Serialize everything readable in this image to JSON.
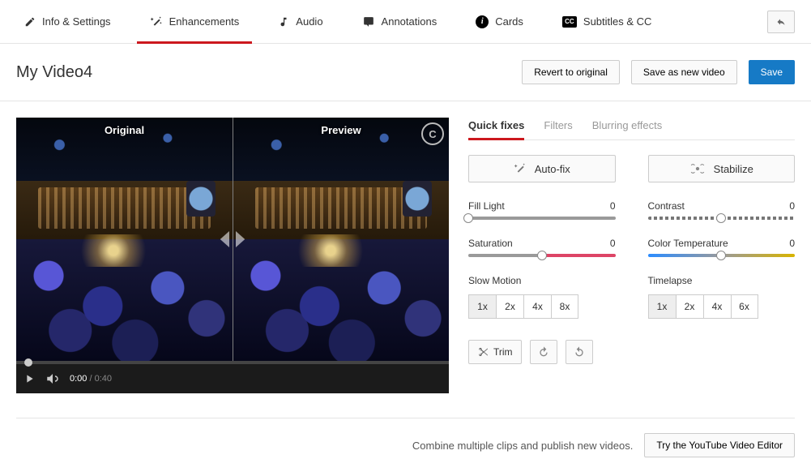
{
  "nav": {
    "info": "Info & Settings",
    "enhancements": "Enhancements",
    "audio": "Audio",
    "annotations": "Annotations",
    "cards": "Cards",
    "cc_badge": "CC",
    "subtitles": "Subtitles & CC"
  },
  "title": "My Video4",
  "actions": {
    "revert": "Revert to original",
    "save_new": "Save as new video",
    "save": "Save"
  },
  "preview": {
    "original_label": "Original",
    "preview_label": "Preview",
    "time_current": "0:00",
    "time_total": "0:40"
  },
  "tabs": {
    "quick_fixes": "Quick fixes",
    "filters": "Filters",
    "blurring": "Blurring effects"
  },
  "quickfix": {
    "auto_fix": "Auto-fix",
    "stabilize": "Stabilize",
    "fill_light": {
      "label": "Fill Light",
      "value": "0"
    },
    "contrast": {
      "label": "Contrast",
      "value": "0"
    },
    "saturation": {
      "label": "Saturation",
      "value": "0"
    },
    "color_temp": {
      "label": "Color Temperature",
      "value": "0"
    },
    "slow_motion": {
      "label": "Slow Motion",
      "opts": [
        "1x",
        "2x",
        "4x",
        "8x"
      ]
    },
    "timelapse": {
      "label": "Timelapse",
      "opts": [
        "1x",
        "2x",
        "4x",
        "6x"
      ]
    },
    "trim": "Trim"
  },
  "footer": {
    "combine_text": "Combine multiple clips and publish new videos.",
    "try_editor": "Try the YouTube Video Editor"
  }
}
